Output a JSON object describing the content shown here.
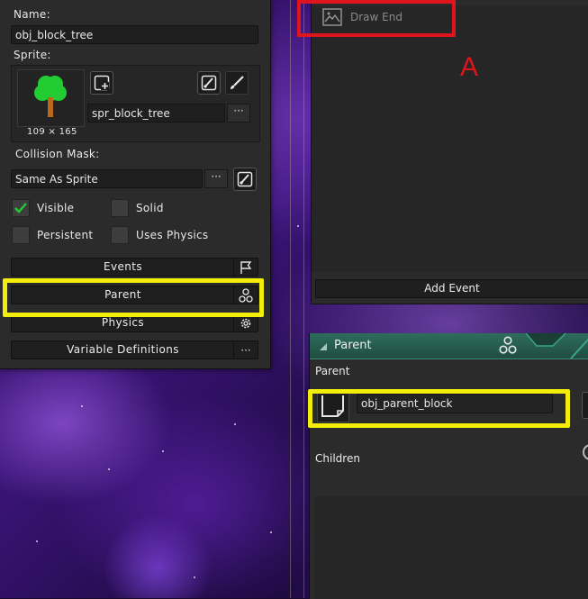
{
  "object_panel": {
    "name_label": "Name:",
    "name_value": "obj_block_tree",
    "sprite_label": "Sprite:",
    "sprite_name": "spr_block_tree",
    "sprite_dimensions": "109 × 165",
    "collision_mask_label": "Collision Mask:",
    "collision_mask_value": "Same As Sprite",
    "options_glyph": "···",
    "checkboxes": {
      "visible": {
        "label": "Visible",
        "checked": true
      },
      "solid": {
        "label": "Solid",
        "checked": false
      },
      "persistent": {
        "label": "Persistent",
        "checked": false
      },
      "uses_physics": {
        "label": "Uses Physics",
        "checked": false
      }
    },
    "buttons": {
      "events": "Events",
      "parent": "Parent",
      "physics": "Physics",
      "variable_definitions": "Variable Definitions"
    }
  },
  "events_panel": {
    "event_name": "Draw End",
    "add_event_label": "Add Event",
    "annotation": "A"
  },
  "parent_panel": {
    "title": "Parent",
    "parent_section_label": "Parent",
    "parent_value": "obj_parent_block",
    "children_label": "Children"
  },
  "colors": {
    "highlight_yellow": "#f2ee0a",
    "annotation_red": "#e0141c",
    "parent_header_teal": "#2e6d5c",
    "checkbox_green": "#22cc33"
  },
  "icons": [
    "add-sprite-icon",
    "edit-sprite-icon",
    "paint-brush-icon",
    "collision-mask-edit-icon",
    "flag-icon",
    "parent-hierarchy-icon",
    "gear-icon",
    "draw-event-icon"
  ]
}
